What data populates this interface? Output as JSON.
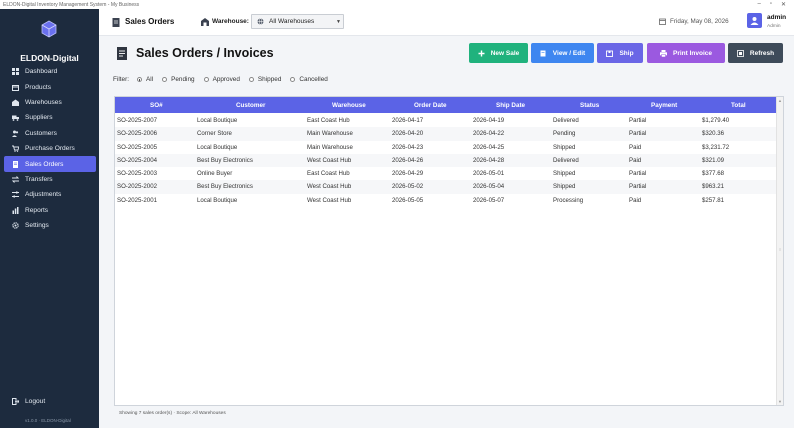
{
  "window": {
    "title": "ELDON-Digital Inventory Management System - My Business"
  },
  "sidebar": {
    "brand": "ELDON-Digital",
    "items": [
      {
        "label": "Dashboard",
        "icon": "dashboard-icon"
      },
      {
        "label": "Products",
        "icon": "box-icon"
      },
      {
        "label": "Warehouses",
        "icon": "warehouse-icon"
      },
      {
        "label": "Suppliers",
        "icon": "truck-icon"
      },
      {
        "label": "Customers",
        "icon": "users-icon"
      },
      {
        "label": "Purchase Orders",
        "icon": "cart-icon"
      },
      {
        "label": "Sales Orders",
        "icon": "receipt-icon",
        "active": true
      },
      {
        "label": "Transfers",
        "icon": "transfer-icon"
      },
      {
        "label": "Adjustments",
        "icon": "sliders-icon"
      },
      {
        "label": "Reports",
        "icon": "chart-icon"
      },
      {
        "label": "Settings",
        "icon": "gear-icon"
      }
    ],
    "logout": "Logout",
    "version": "v1.0.0 · ELDON-Digital"
  },
  "topbar": {
    "title": "Sales Orders",
    "warehouse_label": "Warehouse:",
    "warehouse_value": "All Warehouses",
    "date": "Friday, May 08, 2026",
    "user_name": "admin",
    "user_role": "Admin"
  },
  "page": {
    "title": "Sales Orders / Invoices",
    "buttons": {
      "new": "New Sale",
      "view": "View / Edit",
      "ship": "Ship",
      "print": "Print Invoice",
      "refresh": "Refresh"
    },
    "filter_label": "Filter:",
    "filters": [
      "All",
      "Pending",
      "Approved",
      "Shipped",
      "Cancelled"
    ],
    "filter_selected": "All"
  },
  "table": {
    "columns": [
      "SO#",
      "Customer",
      "Warehouse",
      "Order Date",
      "Ship Date",
      "Status",
      "Payment",
      "Total"
    ],
    "rows": [
      [
        "SO-2025-2007",
        "Local Boutique",
        "East Coast Hub",
        "2026-04-17",
        "2026-04-19",
        "Delivered",
        "Partial",
        "$1,279.40"
      ],
      [
        "SO-2025-2006",
        "Corner Store",
        "Main Warehouse",
        "2026-04-20",
        "2026-04-22",
        "Pending",
        "Partial",
        "$320.36"
      ],
      [
        "SO-2025-2005",
        "Local Boutique",
        "Main Warehouse",
        "2026-04-23",
        "2026-04-25",
        "Shipped",
        "Paid",
        "$3,231.72"
      ],
      [
        "SO-2025-2004",
        "Best Buy Electronics",
        "West Coast Hub",
        "2026-04-26",
        "2026-04-28",
        "Delivered",
        "Paid",
        "$321.09"
      ],
      [
        "SO-2025-2003",
        "Online Buyer",
        "East Coast Hub",
        "2026-04-29",
        "2026-05-01",
        "Shipped",
        "Partial",
        "$377.68"
      ],
      [
        "SO-2025-2002",
        "Best Buy Electronics",
        "West Coast Hub",
        "2026-05-02",
        "2026-05-04",
        "Shipped",
        "Partial",
        "$963.21"
      ],
      [
        "SO-2025-2001",
        "Local Boutique",
        "West Coast Hub",
        "2026-05-05",
        "2026-05-07",
        "Processing",
        "Paid",
        "$257.81"
      ]
    ]
  },
  "status": "Showing 7 sales order(s)  ·  Scope: All Warehouses",
  "colors": {
    "sidebar": "#1d2b3e",
    "accent": "#5b63e6",
    "new": "#20b27d",
    "view": "#3e86f0",
    "ship": "#6a66e6",
    "print": "#9b59e0",
    "refresh": "#3e4b5a"
  }
}
